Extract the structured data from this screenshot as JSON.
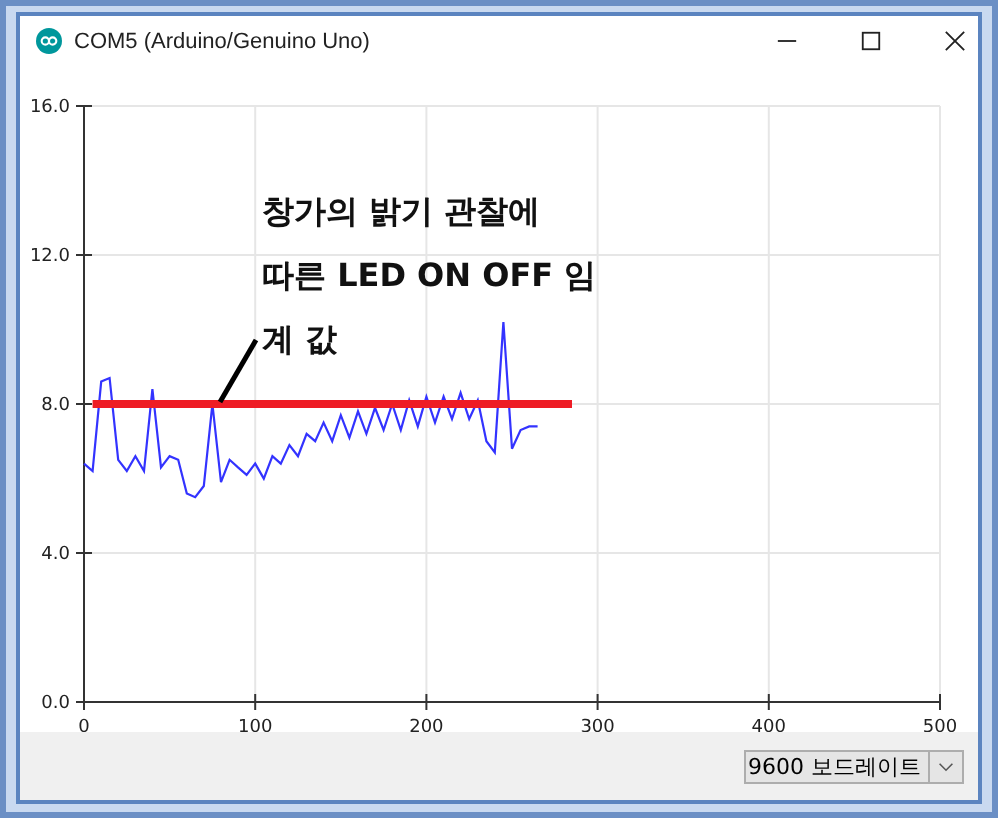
{
  "window": {
    "title": "COM5 (Arduino/Genuino Uno)"
  },
  "plot": {
    "chart_data": {
      "type": "line",
      "x": [
        0,
        5,
        10,
        15,
        20,
        25,
        30,
        35,
        40,
        45,
        50,
        55,
        60,
        65,
        70,
        75,
        80,
        85,
        90,
        95,
        100,
        105,
        110,
        115,
        120,
        125,
        130,
        135,
        140,
        145,
        150,
        155,
        160,
        165,
        170,
        175,
        180,
        185,
        190,
        195,
        200,
        205,
        210,
        215,
        220,
        225,
        230,
        235,
        240,
        245,
        250,
        255,
        260,
        265,
        270,
        275,
        280,
        285
      ],
      "series": [
        {
          "color": "#3333ff",
          "values": [
            6.4,
            6.2,
            8.6,
            8.7,
            6.5,
            6.2,
            6.6,
            6.2,
            8.4,
            6.3,
            6.6,
            6.5,
            5.6,
            5.5,
            5.8,
            8.0,
            5.9,
            6.5,
            6.3,
            6.1,
            6.4,
            6.0,
            6.6,
            6.4,
            6.9,
            6.6,
            7.2,
            7.0,
            7.5,
            7.0,
            7.7,
            7.1,
            7.8,
            7.2,
            7.9,
            7.3,
            8.0,
            7.3,
            8.1,
            7.4,
            8.2,
            7.5,
            8.2,
            7.6,
            8.3,
            7.6,
            8.1,
            7.0,
            6.7,
            10.2,
            6.8,
            7.3,
            7.4,
            7.4,
            null,
            null,
            null,
            null
          ]
        },
        {
          "color": "#ee1c25",
          "values": [
            null,
            8,
            8,
            8,
            8,
            8,
            8,
            8,
            8,
            8,
            8,
            8,
            8,
            8,
            8,
            8,
            8,
            8,
            8,
            8,
            8,
            8,
            8,
            8,
            8,
            8,
            8,
            8,
            8,
            8,
            8,
            8,
            8,
            8,
            8,
            8,
            8,
            8,
            8,
            8,
            8,
            8,
            8,
            8,
            8,
            8,
            8,
            8,
            8,
            8,
            8,
            8,
            8,
            8,
            8,
            8,
            8,
            8
          ]
        }
      ],
      "xlim": [
        0,
        500
      ],
      "ylim": [
        0,
        16
      ],
      "grid": true,
      "xticks": [
        0,
        100,
        200,
        300,
        400,
        500
      ],
      "yticks": [
        {
          "value": 0,
          "label": "0.0"
        },
        {
          "value": 4,
          "label": "4.0"
        },
        {
          "value": 8,
          "label": "8.0"
        },
        {
          "value": 12,
          "label": "12.0"
        },
        {
          "value": 16,
          "label": "16.0"
        }
      ],
      "annotations": [
        {
          "text": "창가의 밝기 관찰에"
        },
        {
          "text": "따른 LED ON OFF 임"
        },
        {
          "text": "계 값"
        }
      ]
    }
  },
  "baud_select": {
    "value": "9600 보드레이트"
  }
}
